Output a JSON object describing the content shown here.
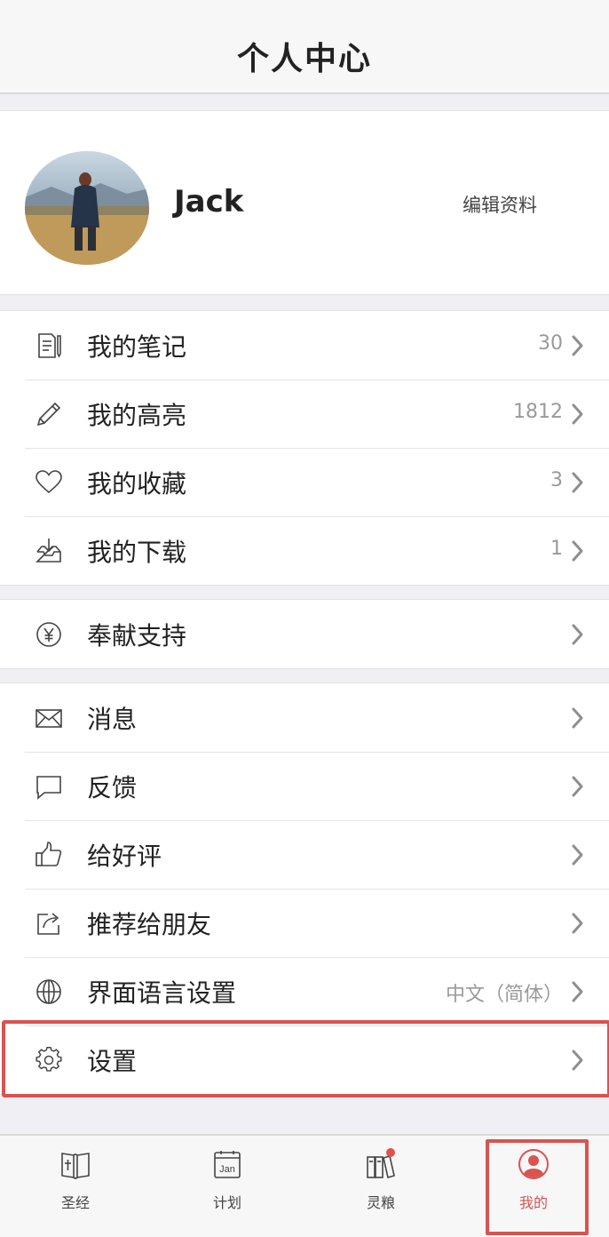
{
  "header": {
    "title": "个人中心"
  },
  "profile": {
    "name": "Jack",
    "edit_label": "编辑资料"
  },
  "groups": [
    {
      "items": [
        {
          "label": "我的笔记",
          "value": "30",
          "icon": "note-icon"
        },
        {
          "label": "我的高亮",
          "value": "1812",
          "icon": "pencil-icon"
        },
        {
          "label": "我的收藏",
          "value": "3",
          "icon": "heart-icon"
        },
        {
          "label": "我的下载",
          "value": "1",
          "icon": "download-tray-icon"
        }
      ]
    },
    {
      "items": [
        {
          "label": "奉献支持",
          "value": "",
          "icon": "yen-icon"
        }
      ]
    },
    {
      "items": [
        {
          "label": "消息",
          "value": "",
          "icon": "mail-icon"
        },
        {
          "label": "反馈",
          "value": "",
          "icon": "chat-bubble-icon"
        },
        {
          "label": "给好评",
          "value": "",
          "icon": "thumbs-up-icon"
        },
        {
          "label": "推荐给朋友",
          "value": "",
          "icon": "share-icon"
        },
        {
          "label": "界面语言设置",
          "value": "中文（简体）",
          "icon": "globe-icon"
        },
        {
          "label": "设置",
          "value": "",
          "icon": "gear-icon"
        }
      ]
    }
  ],
  "tabs": [
    {
      "label": "圣经",
      "icon": "bible-icon",
      "active": false
    },
    {
      "label": "计划",
      "icon": "calendar-icon",
      "active": false,
      "icon_text": "Jan"
    },
    {
      "label": "灵粮",
      "icon": "books-icon",
      "active": false,
      "badge": true
    },
    {
      "label": "我的",
      "icon": "person-icon",
      "active": true
    }
  ],
  "colors": {
    "accent": "#d9534f",
    "background": "#efeff4"
  }
}
